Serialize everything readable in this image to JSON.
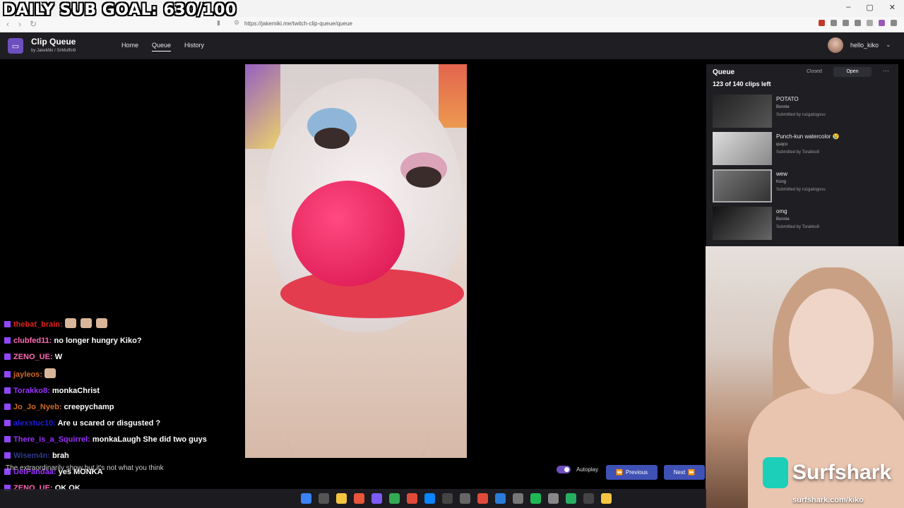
{
  "overlay": {
    "sub_goal": "DAILY SUB GOAL: 630/100"
  },
  "browser": {
    "url": "https://jakemiki.me/twitch-clip-queue/queue"
  },
  "app": {
    "title": "Clip Queue",
    "by_text": "by JakeMiki / SirMuffin9",
    "nav": [
      "Home",
      "Queue",
      "History"
    ],
    "active_nav": "Queue",
    "user_name": "hello_kiko"
  },
  "queue": {
    "title": "Queue",
    "count_text": "123 of 140 clips left",
    "closed_label": "Closed",
    "open_label": "Open",
    "clips": [
      {
        "title": "POTATO",
        "channel": "Bonnie",
        "submitted": "Submitted by ruzgatogosu"
      },
      {
        "title": "Punch-kun watercolor 😢",
        "channel": "quqco",
        "submitted": "Submitted by Torakko8"
      },
      {
        "title": "wew",
        "channel": "Kong",
        "submitted": "Submitted by ruzgatogosu"
      },
      {
        "title": "omg",
        "channel": "Bonnie",
        "submitted": "Submitted by Torakko8"
      }
    ]
  },
  "chat": [
    {
      "user": "thebat_brain",
      "msg": "",
      "color": "#e0231a",
      "emotes": 3
    },
    {
      "user": "clubfed11",
      "msg": "no longer hungry Kiko?",
      "color": "#ff69b4"
    },
    {
      "user": "ZENO_UE",
      "msg": "W",
      "color": "#ff69b4"
    },
    {
      "user": "jayleos",
      "msg": "",
      "color": "#d2691e",
      "emotes": 1
    },
    {
      "user": "Torakko8",
      "msg": "monkaChrist",
      "color": "#9b30ff"
    },
    {
      "user": "Jo_Jo_Nyeb",
      "msg": "creepychamp",
      "color": "#d2691e"
    },
    {
      "user": "alexstuc10",
      "msg": "Are u scared or disgusted ?",
      "color": "#1e1ee0"
    },
    {
      "user": "There_is_a_Squirrel",
      "msg": "monkaLaugh She did two guys",
      "color": "#9b30ff"
    },
    {
      "user": "Wisem4n",
      "msg": "brah",
      "color": "#2e3a8c"
    },
    {
      "user": "UetPandaa",
      "msg": "yes MONKA",
      "color": "#9b30ff"
    },
    {
      "user": "ZENO_UE",
      "msg": "OK OK",
      "color": "#ff69b4"
    }
  ],
  "clip_caption": "The extraordinarily show but it's not what you think",
  "controls": {
    "autoplay": "Autoplay",
    "previous": "Previous",
    "next": "Next"
  },
  "sponsor": {
    "name": "Surfshark",
    "url": "surfshark.com/kiko"
  }
}
